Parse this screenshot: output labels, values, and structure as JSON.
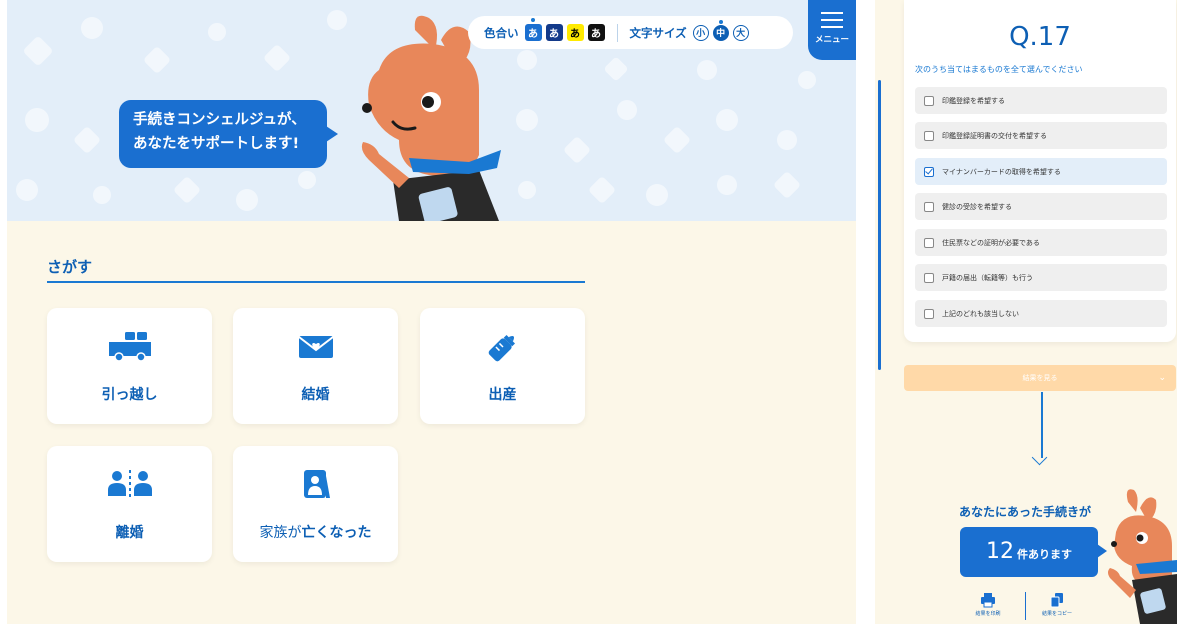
{
  "header": {
    "color_label": "色合い",
    "color_swatches": [
      {
        "char": "あ",
        "bg": "#1a6fd0",
        "fg": "#ffffff",
        "active": true
      },
      {
        "char": "あ",
        "bg": "#133a8a",
        "fg": "#ffffff",
        "active": false
      },
      {
        "char": "あ",
        "bg": "#ffea00",
        "fg": "#000000",
        "active": false
      },
      {
        "char": "あ",
        "bg": "#111111",
        "fg": "#ffffff",
        "active": false
      }
    ],
    "font_label": "文字サイズ",
    "font_sizes": [
      {
        "char": "小",
        "active": false
      },
      {
        "char": "中",
        "active": true
      },
      {
        "char": "大",
        "active": false
      }
    ],
    "menu_label": "メニュー"
  },
  "hero": {
    "bubble_line1": "手続きコンシェルジュが、",
    "bubble_line2": "あなたをサポートします!"
  },
  "search": {
    "title": "さがす",
    "categories": [
      {
        "icon": "moving-truck-icon",
        "label": "引っ越し"
      },
      {
        "icon": "envelope-heart-icon",
        "label": "結婚"
      },
      {
        "icon": "baby-bottle-icon",
        "label": "出産"
      },
      {
        "icon": "divorce-people-icon",
        "label": "離婚"
      },
      {
        "icon": "memorial-photo-icon",
        "label_prefix": "家族が",
        "label_main": "亡くなった"
      }
    ]
  },
  "question": {
    "number": "Q.17",
    "prompt": "次のうち当てはまるものを全て選んでください",
    "options": [
      {
        "label": "印鑑登録を希望する",
        "checked": false
      },
      {
        "label": "印鑑登録証明書の交付を希望する",
        "checked": false
      },
      {
        "label": "マイナンバーカードの取得を希望する",
        "checked": true
      },
      {
        "label": "健診の受診を希望する",
        "checked": false
      },
      {
        "label": "住民票などの証明が必要である",
        "checked": false
      },
      {
        "label": "戸籍の届出（転籍等）も行う",
        "checked": false
      },
      {
        "label": "上記のどれも該当しない",
        "checked": false
      }
    ],
    "result_button": "結果を見る"
  },
  "result": {
    "headline": "あなたにあった手続きが",
    "count": "12",
    "count_suffix": "件あります",
    "print_label": "結果を印刷",
    "copy_label": "結果をコピー"
  },
  "colors": {
    "primary": "#1a6fd0",
    "dark_text": "#0d5fb4",
    "hero_bg": "#e3eef9",
    "page_bg": "#fcf7e8",
    "result_button_bg": "#ffd9a8",
    "mascot_orange": "#e8875a"
  }
}
